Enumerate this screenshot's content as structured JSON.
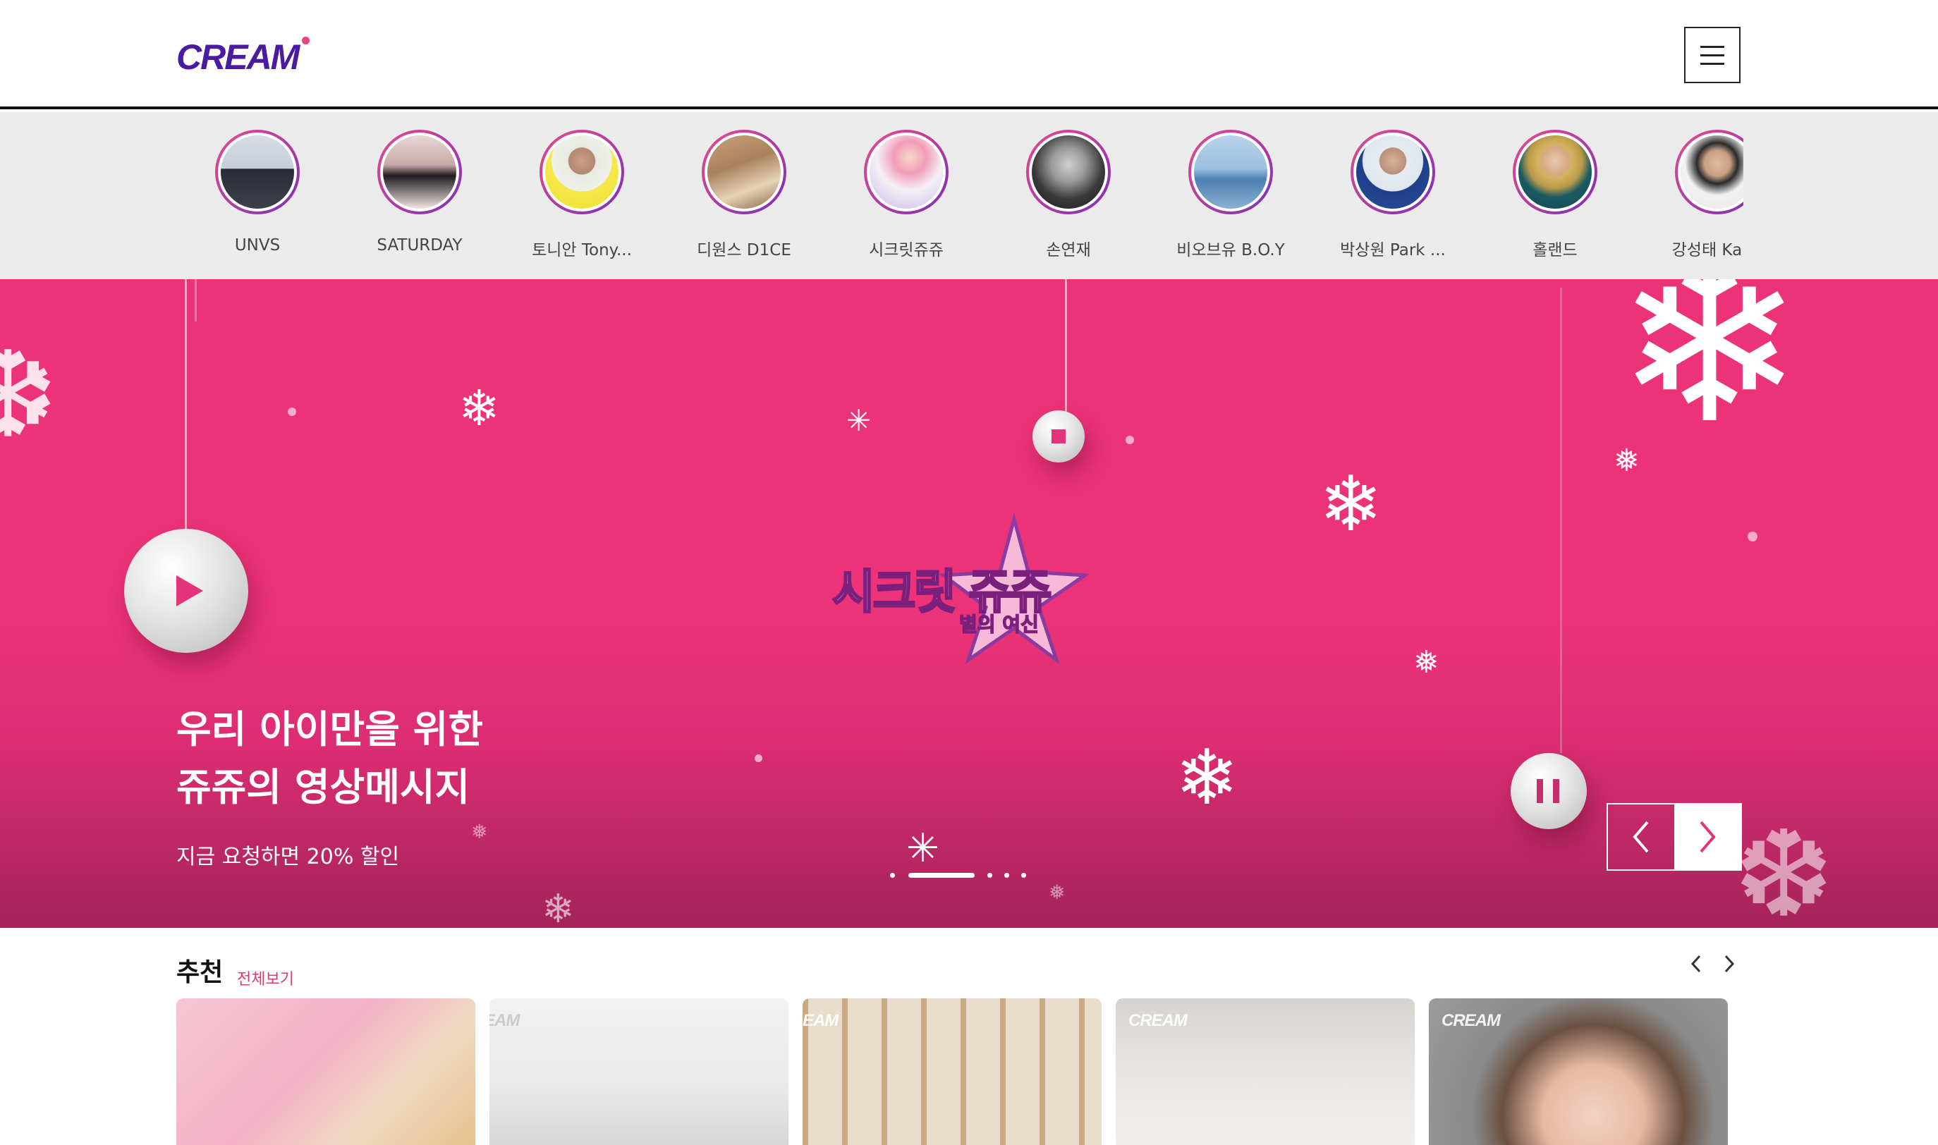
{
  "header": {
    "logo_text": "CREAM",
    "menu_icon": "hamburger-menu-icon"
  },
  "artists": [
    {
      "name": "UNVS"
    },
    {
      "name": "SATURDAY"
    },
    {
      "name": "토니안 Tony..."
    },
    {
      "name": "디원스 D1CE"
    },
    {
      "name": "시크릿쥬쥬"
    },
    {
      "name": "손연재"
    },
    {
      "name": "비오브유 B.O.Y"
    },
    {
      "name": "박상원 Park ..."
    },
    {
      "name": "홀랜드"
    },
    {
      "name": "강성태 Kang"
    }
  ],
  "hero": {
    "logo_title": "시크릿 쥬쥬",
    "logo_subtitle": "별의 여신",
    "title_line1": "우리 아이만을 위한",
    "title_line2": "쥬쥬의 영상메시지",
    "description": "지금 요청하면 20% 할인",
    "slide_count": 5,
    "active_slide": 2,
    "colors": {
      "background": "#ec3278",
      "accent": "#e4337a"
    }
  },
  "recommend": {
    "title": "추천",
    "view_all": "전체보기",
    "cards": [
      {
        "badge": ""
      },
      {
        "badge": "EAM"
      },
      {
        "badge": "EAM"
      },
      {
        "badge": "CREAM"
      },
      {
        "badge": "CREAM"
      }
    ]
  }
}
